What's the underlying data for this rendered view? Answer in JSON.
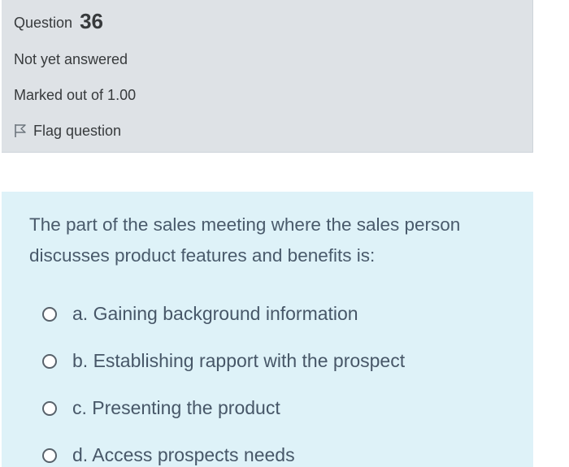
{
  "question": {
    "label": "Question",
    "number": "36",
    "state": "Not yet answered",
    "grade": "Marked out of 1.00",
    "flag_label": "Flag question",
    "flag_icon": "flag-icon"
  },
  "prompt": "The part of the sales meeting where the sales person discusses product features and benefits is:",
  "answers": [
    {
      "label": "a. Gaining background information"
    },
    {
      "label": "b. Establishing rapport with the prospect"
    },
    {
      "label": "c. Presenting the product"
    },
    {
      "label": "d. Access prospects needs"
    }
  ],
  "colors": {
    "info_bg": "#dee2e6",
    "content_bg": "#def2f8",
    "text": "#373a3c",
    "question_text": "#495a6b"
  }
}
